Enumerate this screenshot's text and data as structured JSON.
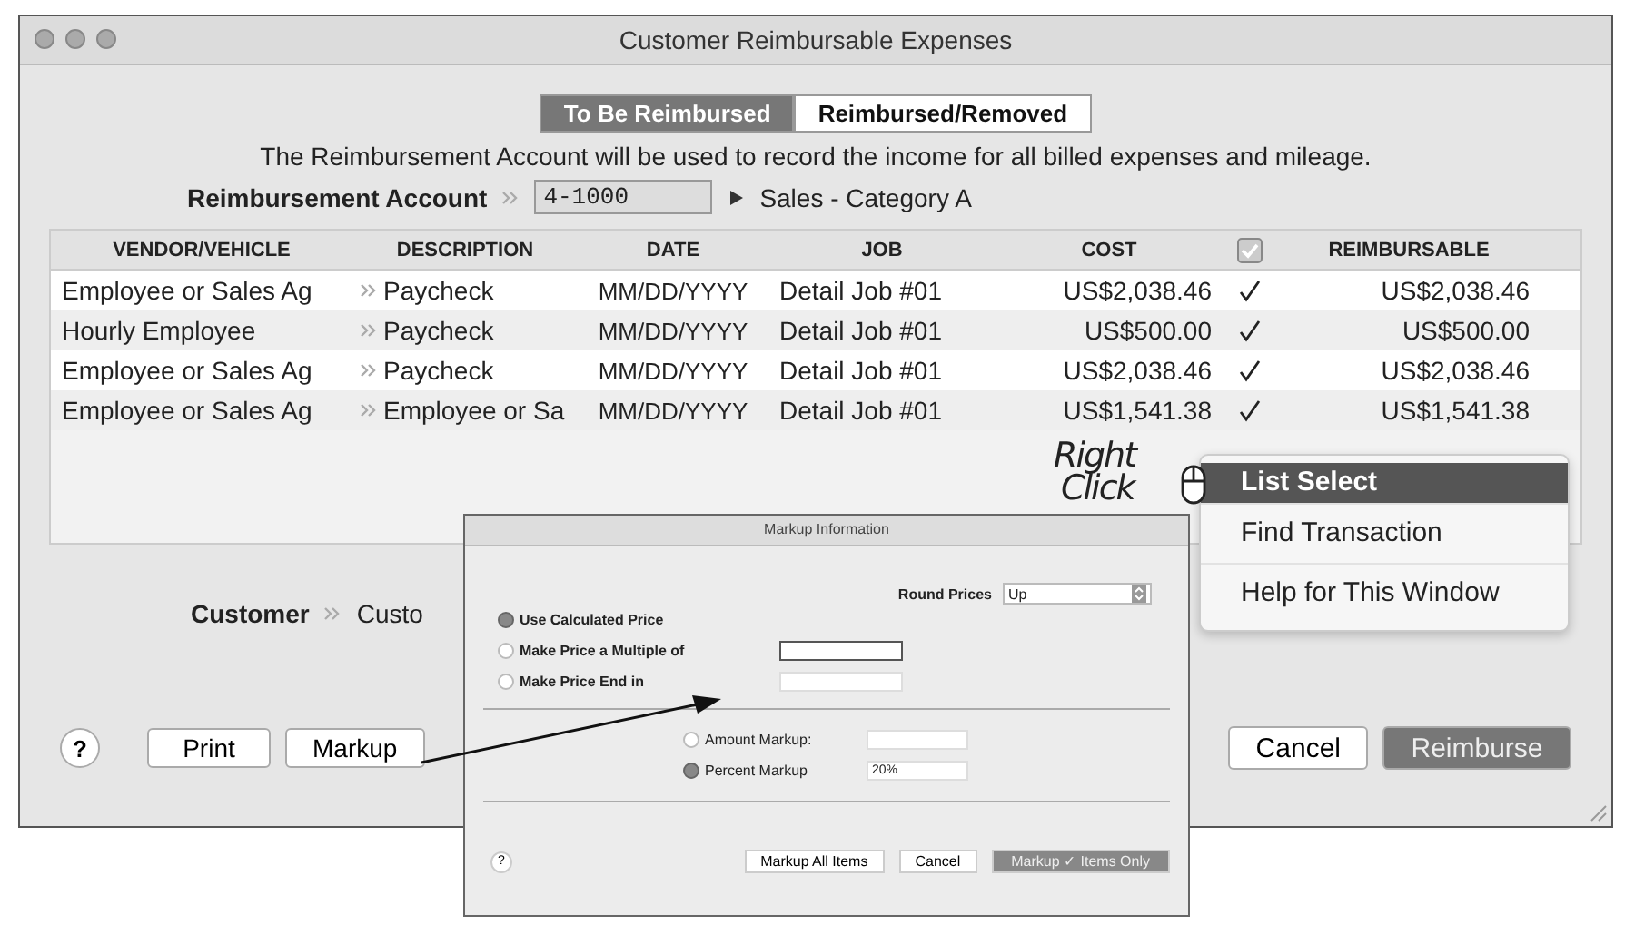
{
  "window": {
    "title": "Customer Reimbursable Expenses"
  },
  "tabs": [
    {
      "label": "To Be Reimbursed",
      "selected": true
    },
    {
      "label": "Reimbursed/Removed",
      "selected": false
    }
  ],
  "info_text": "The Reimbursement Account will be used to record the income for all billed expenses and mileage.",
  "account": {
    "label": "Reimbursement Account",
    "value": "4-1000",
    "name": "Sales - Category A"
  },
  "table": {
    "columns": [
      "VENDOR/VEHICLE",
      "DESCRIPTION",
      "DATE",
      "JOB",
      "COST",
      "REIMBURSABLE"
    ],
    "all_checked": true,
    "rows": [
      {
        "vendor": "Employee or Sales Ag",
        "description": "Paycheck",
        "date": "MM/DD/YYYY",
        "job": "Detail Job #01",
        "cost": "US$2,038.46",
        "checked": true,
        "reimbursable": "US$2,038.46"
      },
      {
        "vendor": "Hourly Employee",
        "description": "Paycheck",
        "date": "MM/DD/YYYY",
        "job": "Detail Job #01",
        "cost": "US$500.00",
        "checked": true,
        "reimbursable": "US$500.00"
      },
      {
        "vendor": "Employee or Sales Ag",
        "description": "Paycheck",
        "date": "MM/DD/YYYY",
        "job": "Detail Job #01",
        "cost": "US$2,038.46",
        "checked": true,
        "reimbursable": "US$2,038.46"
      },
      {
        "vendor": "Employee or Sales Ag",
        "description": "Employee or Sa",
        "date": "MM/DD/YYYY",
        "job": "Detail Job #01",
        "cost": "US$1,541.38",
        "checked": true,
        "reimbursable": "US$1,541.38"
      }
    ]
  },
  "customer": {
    "label": "Customer",
    "value": "Custo"
  },
  "buttons_left": [
    "?",
    "Print",
    "Markup"
  ],
  "buttons_right": [
    {
      "label": "Cancel",
      "default": false
    },
    {
      "label": "Reimburse",
      "default": true
    }
  ],
  "annotation": {
    "line1": "Right",
    "line2": "Click"
  },
  "context_menu": [
    {
      "label": "List Select",
      "selected": true
    },
    {
      "label": "Find Transaction",
      "selected": false
    },
    {
      "label": "Help for This Window",
      "selected": false
    }
  ],
  "dialog": {
    "title": "Markup Information",
    "round_label": "Round Prices",
    "round_value": "Up",
    "price_options": [
      {
        "label": "Use Calculated Price",
        "selected": true,
        "field": false
      },
      {
        "label": "Make Price a Multiple of",
        "selected": false,
        "field": true
      },
      {
        "label": "Make Price End in",
        "selected": false,
        "field": true
      }
    ],
    "markup_options": [
      {
        "label": "Amount Markup:",
        "selected": false
      },
      {
        "label": "Percent Markup",
        "selected": true,
        "value": "20%"
      }
    ],
    "help": "?",
    "buttons": [
      {
        "label": "Markup All Items",
        "default": false
      },
      {
        "label": "Cancel",
        "default": false
      },
      {
        "label": "Markup ✓ Items Only",
        "default": true
      }
    ]
  }
}
